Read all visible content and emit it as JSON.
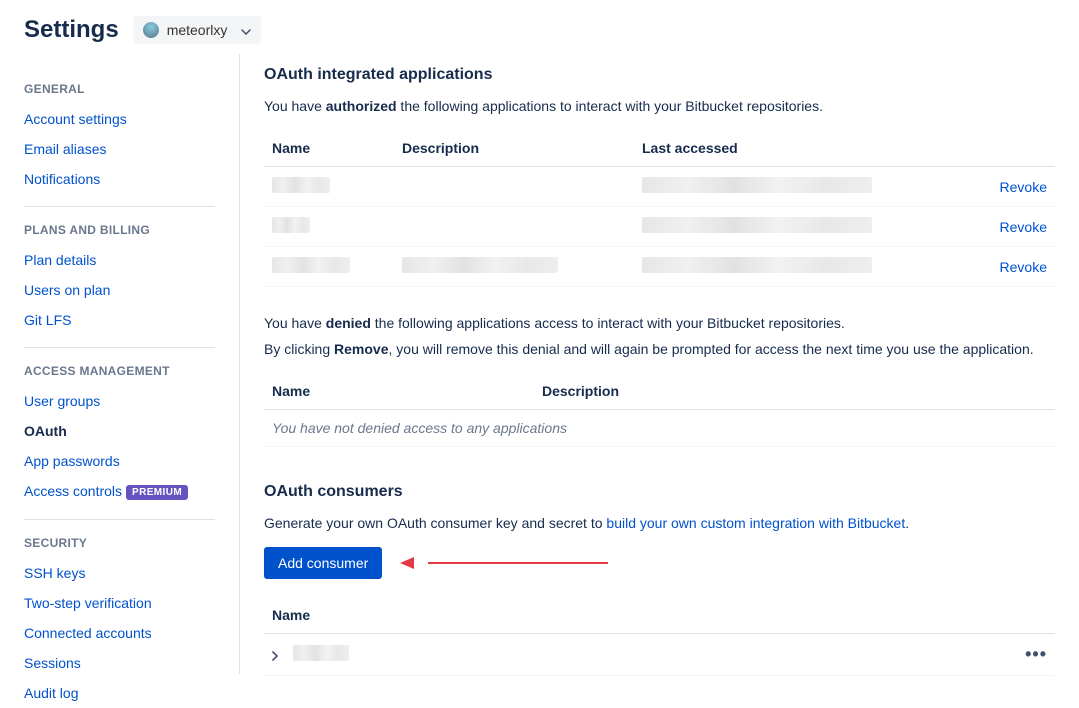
{
  "header": {
    "title": "Settings",
    "user": "meteorlxy"
  },
  "sidebar": {
    "groups": [
      {
        "label": "GENERAL",
        "items": [
          {
            "label": "Account settings",
            "active": false
          },
          {
            "label": "Email aliases",
            "active": false
          },
          {
            "label": "Notifications",
            "active": false
          }
        ]
      },
      {
        "label": "PLANS AND BILLING",
        "items": [
          {
            "label": "Plan details",
            "active": false
          },
          {
            "label": "Users on plan",
            "active": false
          },
          {
            "label": "Git LFS",
            "active": false
          }
        ]
      },
      {
        "label": "ACCESS MANAGEMENT",
        "items": [
          {
            "label": "User groups",
            "active": false
          },
          {
            "label": "OAuth",
            "active": true
          },
          {
            "label": "App passwords",
            "active": false
          },
          {
            "label": "Access controls",
            "active": false,
            "badge": "PREMIUM"
          }
        ]
      },
      {
        "label": "SECURITY",
        "items": [
          {
            "label": "SSH keys",
            "active": false
          },
          {
            "label": "Two-step verification",
            "active": false
          },
          {
            "label": "Connected accounts",
            "active": false
          },
          {
            "label": "Sessions",
            "active": false
          },
          {
            "label": "Audit log",
            "active": false
          }
        ]
      }
    ]
  },
  "oauth_integrated": {
    "title": "OAuth integrated applications",
    "authorized_intro_pre": "You have ",
    "authorized_intro_strong": "authorized",
    "authorized_intro_post": " the following applications to interact with your Bitbucket repositories.",
    "columns": {
      "name": "Name",
      "description": "Description",
      "last_accessed": "Last accessed"
    },
    "authorized_rows": [
      {
        "revoke": "Revoke"
      },
      {
        "revoke": "Revoke"
      },
      {
        "revoke": "Revoke"
      }
    ],
    "denied_intro_pre": "You have ",
    "denied_intro_strong": "denied",
    "denied_intro_post": " the following applications access to interact with your Bitbucket repositories.",
    "denied_remove_pre": "By clicking ",
    "denied_remove_strong": "Remove",
    "denied_remove_post": ", you will remove this denial and will again be prompted for access the next time you use the application.",
    "denied_columns": {
      "name": "Name",
      "description": "Description"
    },
    "denied_empty": "You have not denied access to any applications"
  },
  "oauth_consumers": {
    "title": "OAuth consumers",
    "intro_pre": "Generate your own OAuth consumer key and secret to ",
    "intro_link": "build your own custom integration with Bitbucket",
    "intro_post": ".",
    "add_button": "Add consumer",
    "columns": {
      "name": "Name"
    }
  }
}
